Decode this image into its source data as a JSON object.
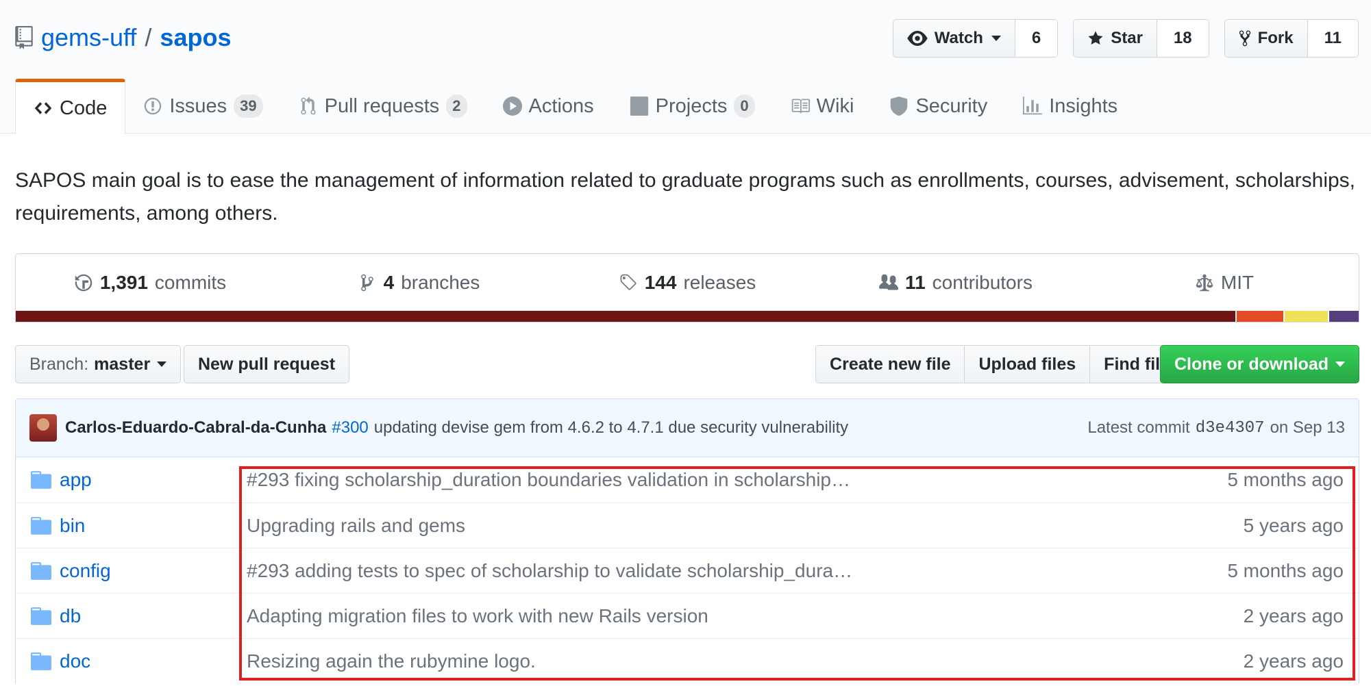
{
  "repo": {
    "owner": "gems-uff",
    "name": "sapos"
  },
  "actions": [
    {
      "label": "Watch",
      "count": "6",
      "icon": "eye-icon"
    },
    {
      "label": "Star",
      "count": "18",
      "icon": "star-icon"
    },
    {
      "label": "Fork",
      "count": "11",
      "icon": "fork-icon"
    }
  ],
  "tabs": [
    {
      "label": "Code",
      "icon": "code-icon"
    },
    {
      "label": "Issues",
      "counter": "39",
      "icon": "issue-icon"
    },
    {
      "label": "Pull requests",
      "counter": "2",
      "icon": "pull-request-icon"
    },
    {
      "label": "Actions",
      "icon": "play-icon"
    },
    {
      "label": "Projects",
      "counter": "0",
      "icon": "project-icon"
    },
    {
      "label": "Wiki",
      "icon": "book-icon"
    },
    {
      "label": "Security",
      "icon": "shield-icon"
    },
    {
      "label": "Insights",
      "icon": "graph-icon"
    }
  ],
  "description": "SAPOS main goal is to ease the management of information related to graduate programs such as enrollments, courses, advisement, scholarships, requirements, among others.",
  "summary": {
    "commits": {
      "num": "1,391",
      "label": "commits"
    },
    "branches": {
      "num": "4",
      "label": "branches"
    },
    "releases": {
      "num": "144",
      "label": "releases"
    },
    "contributors": {
      "num": "11",
      "label": "contributors"
    },
    "license": "MIT"
  },
  "language_bar": [
    {
      "color": "#701516",
      "percent": 91.9
    },
    {
      "color": "#e34c26",
      "percent": 3.6
    },
    {
      "color": "#f1e05a",
      "percent": 3.4
    },
    {
      "color": "#563d7c",
      "percent": 2.3
    }
  ],
  "filenav": {
    "branch_prefix": "Branch:",
    "branch": "master",
    "new_pr": "New pull request",
    "create_file": "Create new file",
    "upload_files": "Upload files",
    "find_file": "Find file",
    "clone": "Clone or download"
  },
  "commit": {
    "author": "Carlos-Eduardo-Cabral-da-Cunha",
    "pr": "#300",
    "message": "updating devise gem from 4.6.2 to 4.7.1 due security vulnerability",
    "latest_label": "Latest commit",
    "sha": "d3e4307",
    "date": "on Sep 13"
  },
  "files": [
    {
      "name": "app",
      "message": "#293 fixing scholarship_duration boundaries validation in scholarship…",
      "age": "5 months ago"
    },
    {
      "name": "bin",
      "message": "Upgrading rails and gems",
      "age": "5 years ago"
    },
    {
      "name": "config",
      "message": "#293 adding tests to spec of scholarship to validate scholarship_dura…",
      "age": "5 months ago"
    },
    {
      "name": "db",
      "message": "Adapting migration files to work with new Rails version",
      "age": "2 years ago"
    },
    {
      "name": "doc",
      "message": "Resizing again the rubymine logo.",
      "age": "2 years ago"
    }
  ],
  "colors": {
    "link": "#0366d6",
    "accent_tab": "#e36209",
    "clone_green": "#28a745",
    "highlight_box": "#e02020"
  }
}
